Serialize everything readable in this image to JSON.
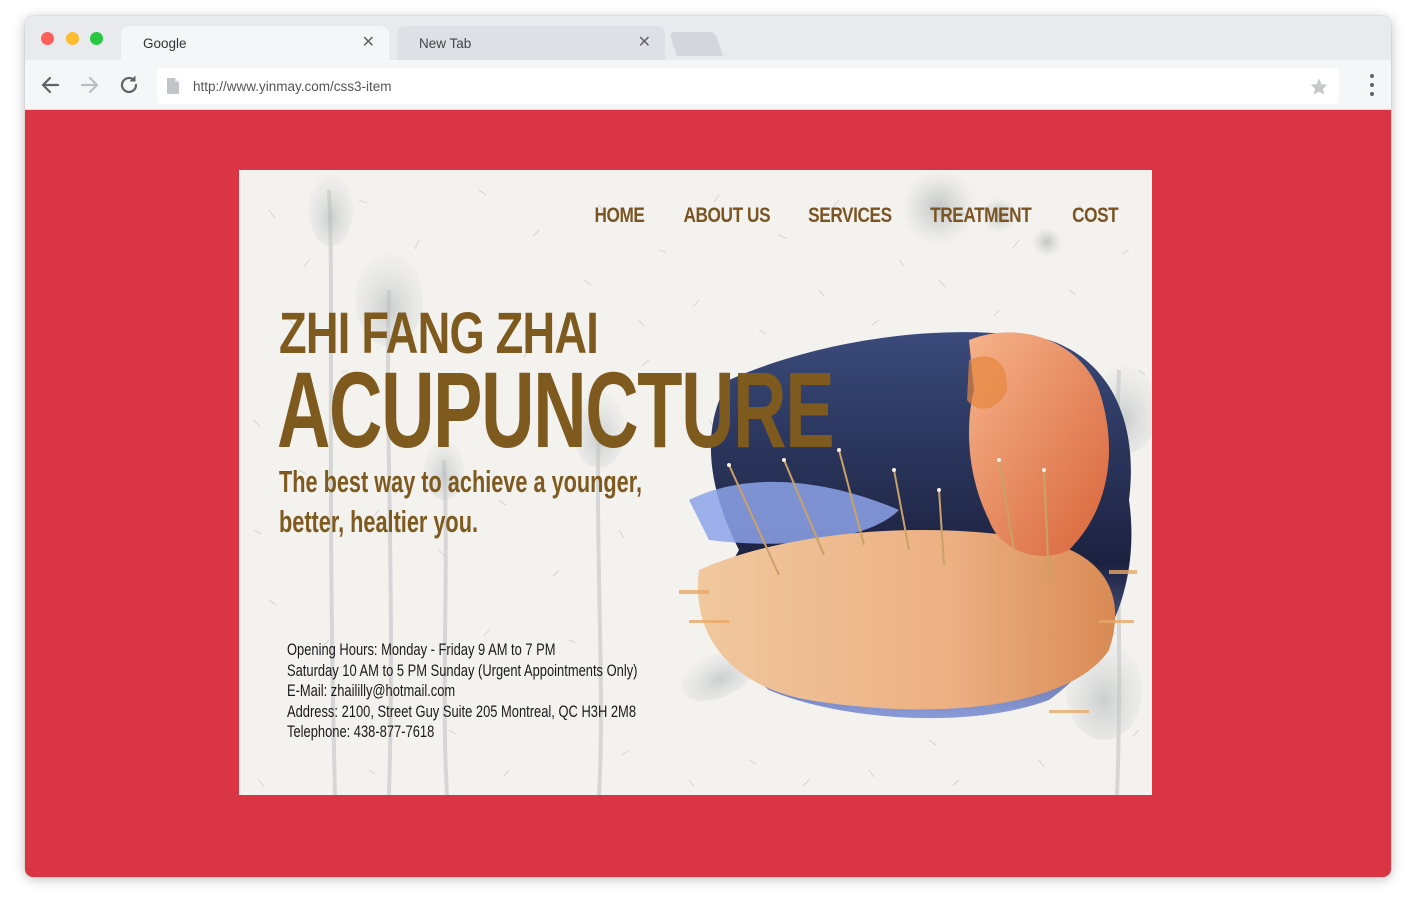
{
  "browser": {
    "tabs": [
      {
        "title": "Google",
        "active": true
      },
      {
        "title": "New Tab",
        "active": false
      }
    ],
    "url": "http://www.yinmay.com/css3-item",
    "page_background": "#d93545"
  },
  "site": {
    "nav": [
      "HOME",
      "ABOUT US",
      "SERVICES",
      "TREATMENT",
      "COST"
    ],
    "title_line1": "ZHI FANG ZHAI",
    "title_line2": "ACUPUNCTURE",
    "tagline": "The best way to achieve a younger, better, healtier you.",
    "tagline_lines": [
      "The best way to achieve a younger,",
      "better, healtier you."
    ],
    "info": [
      "Opening Hours: Monday - Friday 9 AM to 7 PM",
      "Saturday 10 AM to 5 PM  Sunday (Urgent Appointments Only)",
      "E-Mail:  zhaililly@hotmail.com",
      "Address: 2100, Street Guy Suite 205 Montreal, QC  H3H  2M8",
      "Telephone: 438-877-7618"
    ],
    "colors": {
      "brand_brown": "#7f5a1f",
      "paper": "#f3f2ef"
    }
  }
}
